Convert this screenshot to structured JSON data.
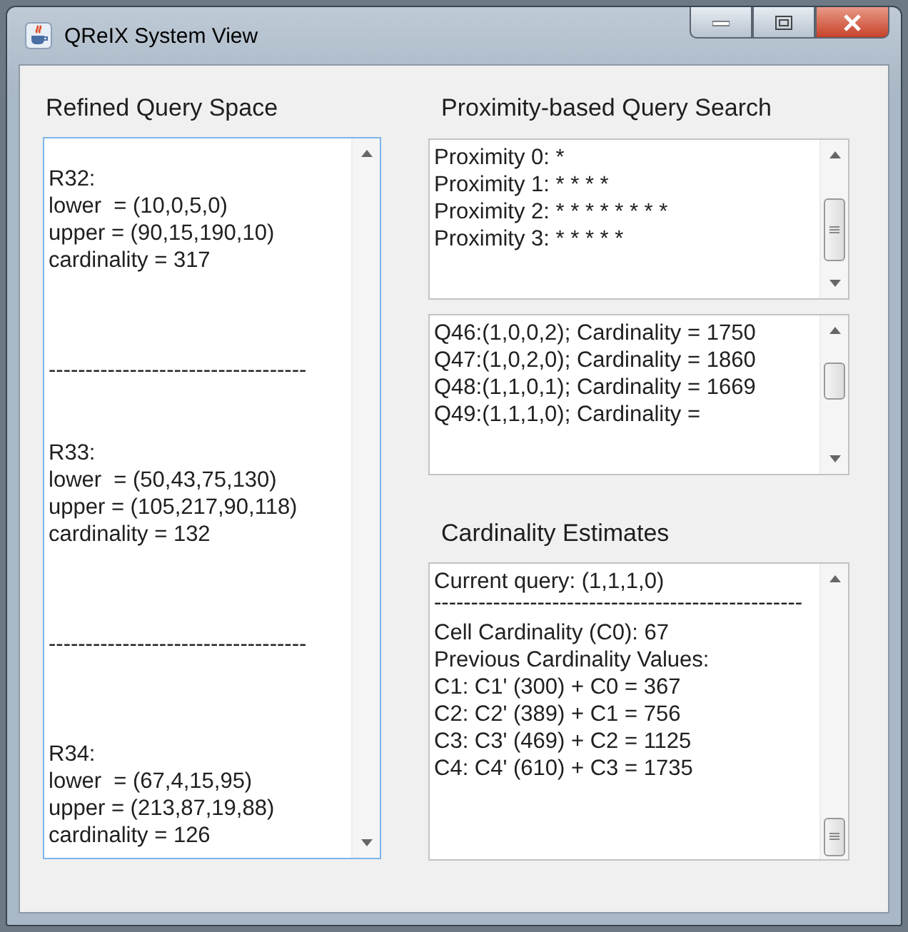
{
  "window": {
    "title": "QReIX System View"
  },
  "refined_query_space": {
    "heading": "Refined Query Space",
    "blocks": [
      {
        "kind": "record",
        "lines": [
          "R32:",
          "lower  = (10,0,5,0)",
          "upper = (90,15,190,10)",
          "cardinality = 317"
        ]
      },
      {
        "kind": "separator",
        "text": "-----------------------------------"
      },
      {
        "kind": "record",
        "lines": [
          "R33:",
          "lower  = (50,43,75,130)",
          "upper = (105,217,90,118)",
          "cardinality = 132"
        ]
      },
      {
        "kind": "separator",
        "text": "-----------------------------------"
      },
      {
        "kind": "record",
        "lines": [
          "R34:",
          "lower  = (67,4,15,95)",
          "upper = (213,87,19,88)",
          "cardinality = 126"
        ]
      }
    ]
  },
  "proximity_search": {
    "heading": "Proximity-based Query Search",
    "proximity_lines": [
      "Proximity 0: *",
      "Proximity 1: * * * *",
      "Proximity 2: * * * * * * * *",
      "Proximity 3: * * * * *"
    ],
    "query_lines": [
      "Q46:(1,0,0,2); Cardinality = 1750",
      "Q47:(1,0,2,0); Cardinality = 1860",
      "Q48:(1,1,0,1); Cardinality = 1669",
      "Q49:(1,1,1,0); Cardinality ="
    ]
  },
  "cardinality_estimates": {
    "heading": "Cardinality Estimates",
    "blocks": [
      {
        "kind": "text",
        "text": "Current query: (1,1,1,0)"
      },
      {
        "kind": "separator",
        "text": "--------------------------------------------------"
      },
      {
        "kind": "text",
        "text": "Cell Cardinality (C0): 67"
      },
      {
        "kind": "text",
        "text": "Previous Cardinality Values:"
      },
      {
        "kind": "text",
        "text": "C1: C1' (300) + C0 = 367"
      },
      {
        "kind": "text",
        "text": "C2: C2' (389) + C1 = 756"
      },
      {
        "kind": "text",
        "text": "C3: C3' (469) + C2 = 1125"
      },
      {
        "kind": "text",
        "text": "C4: C4' (610) + C3 = 1735"
      }
    ]
  }
}
